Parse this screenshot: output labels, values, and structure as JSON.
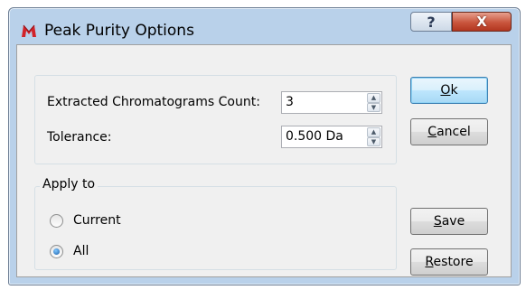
{
  "window": {
    "title": "Peak Purity Options"
  },
  "titlebar": {
    "help_glyph": "?",
    "close_glyph": "X"
  },
  "fields": {
    "extracted_label": "Extracted Chromatograms Count:",
    "extracted_value": "3",
    "tolerance_label": "Tolerance:",
    "tolerance_value": "0.500 Da"
  },
  "apply_to": {
    "legend": "Apply to",
    "options": [
      {
        "label": "Current",
        "checked": false
      },
      {
        "label": "All",
        "checked": true
      }
    ]
  },
  "buttons": {
    "ok": {
      "mnemonic": "O",
      "rest": "k"
    },
    "cancel": {
      "mnemonic": "C",
      "rest": "ancel"
    },
    "save": {
      "mnemonic": "S",
      "rest": "ave"
    },
    "restore": {
      "mnemonic": "R",
      "rest": "estore"
    }
  },
  "colors": {
    "accent": "#3c7fb1",
    "close": "#c9553d",
    "frame": "#b9d1ea",
    "app_icon": "#d2232a"
  }
}
